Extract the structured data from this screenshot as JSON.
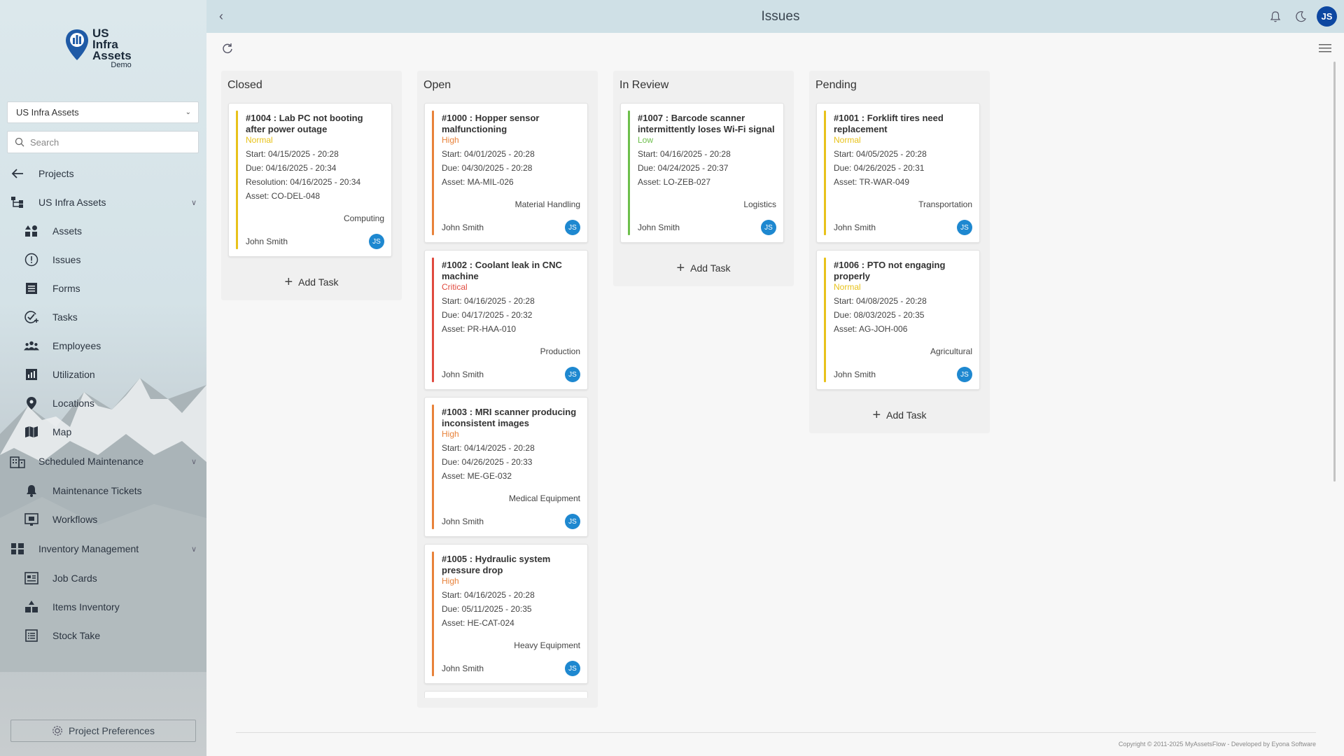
{
  "sidebar": {
    "logo": {
      "line1": "US",
      "line2": "Infra",
      "line3": "Assets",
      "sub": "Demo"
    },
    "project_select": "US Infra Assets",
    "search_placeholder": "Search",
    "items": [
      {
        "label": "Projects",
        "icon": "arrow-left-icon",
        "level": "top"
      },
      {
        "label": "US Infra Assets",
        "icon": "hierarchy-icon",
        "level": "top",
        "expanded": true
      },
      {
        "label": "Assets",
        "icon": "shapes-icon",
        "level": "sub"
      },
      {
        "label": "Issues",
        "icon": "alert-circle-icon",
        "level": "sub"
      },
      {
        "label": "Forms",
        "icon": "form-icon",
        "level": "sub"
      },
      {
        "label": "Tasks",
        "icon": "task-check-icon",
        "level": "sub"
      },
      {
        "label": "Employees",
        "icon": "people-icon",
        "level": "sub"
      },
      {
        "label": "Utilization",
        "icon": "bar-chart-icon",
        "level": "sub"
      },
      {
        "label": "Locations",
        "icon": "location-pin-icon",
        "level": "sub"
      },
      {
        "label": "Map",
        "icon": "map-icon",
        "level": "sub"
      },
      {
        "label": "Scheduled Maintenance",
        "icon": "building-icon",
        "level": "top",
        "expanded": false
      },
      {
        "label": "Maintenance Tickets",
        "icon": "bell-icon",
        "level": "sub"
      },
      {
        "label": "Workflows",
        "icon": "workflow-icon",
        "level": "sub"
      },
      {
        "label": "Inventory Management",
        "icon": "grid-icon",
        "level": "top",
        "expanded": false
      },
      {
        "label": "Job Cards",
        "icon": "card-icon",
        "level": "sub"
      },
      {
        "label": "Items Inventory",
        "icon": "boxes-icon",
        "level": "sub"
      },
      {
        "label": "Stock Take",
        "icon": "list-icon",
        "level": "sub"
      }
    ],
    "preferences_label": "Project Preferences"
  },
  "header": {
    "title": "Issues",
    "user_initials": "JS"
  },
  "board": {
    "add_task_label": "Add Task",
    "columns": [
      {
        "title": "Closed",
        "cards": [
          {
            "title": "#1004 : Lab PC not booting after power outage",
            "priority": "Normal",
            "priority_color": "#e8c21a",
            "lines": [
              "Start:  04/15/2025 - 20:28",
              "Due:  04/16/2025 - 20:34",
              "Resolution:  04/16/2025 - 20:34",
              "Asset: CO-DEL-048"
            ],
            "category": "Computing",
            "assignee": "John Smith",
            "initials": "JS"
          }
        ]
      },
      {
        "title": "Open",
        "cards": [
          {
            "title": "#1000 : Hopper sensor malfunctioning",
            "priority": "High",
            "priority_color": "#e8823a",
            "lines": [
              "Start:  04/01/2025 - 20:28",
              "Due:  04/30/2025 - 20:28",
              "Asset: MA-MIL-026"
            ],
            "category": "Material Handling",
            "assignee": "John Smith",
            "initials": "JS"
          },
          {
            "title": "#1002 : Coolant leak in CNC machine",
            "priority": "Critical",
            "priority_color": "#e04a3f",
            "lines": [
              "Start:  04/16/2025 - 20:28",
              "Due:  04/17/2025 - 20:32",
              "Asset: PR-HAA-010"
            ],
            "category": "Production",
            "assignee": "John Smith",
            "initials": "JS"
          },
          {
            "title": "#1003 : MRI scanner producing inconsistent images",
            "priority": "High",
            "priority_color": "#e8823a",
            "lines": [
              "Start:  04/14/2025 - 20:28",
              "Due:  04/26/2025 - 20:33",
              "Asset: ME-GE-032"
            ],
            "category": "Medical Equipment",
            "assignee": "John Smith",
            "initials": "JS"
          },
          {
            "title": "#1005 : Hydraulic system pressure drop",
            "priority": "High",
            "priority_color": "#e8823a",
            "lines": [
              "Start:  04/16/2025 - 20:28",
              "Due:  05/11/2025 - 20:35",
              "Asset: HE-CAT-024"
            ],
            "category": "Heavy Equipment",
            "assignee": "John Smith",
            "initials": "JS"
          }
        ]
      },
      {
        "title": "In Review",
        "cards": [
          {
            "title": "#1007 : Barcode scanner intermittently loses Wi-Fi signal",
            "priority": "Low",
            "priority_color": "#6dbf4b",
            "lines": [
              "Start:  04/16/2025 - 20:28",
              "Due:  04/24/2025 - 20:37",
              "Asset: LO-ZEB-027"
            ],
            "category": "Logistics",
            "assignee": "John Smith",
            "initials": "JS"
          }
        ]
      },
      {
        "title": "Pending",
        "cards": [
          {
            "title": "#1001 : Forklift tires need replacement",
            "priority": "Normal",
            "priority_color": "#e8c21a",
            "lines": [
              "Start:  04/05/2025 - 20:28",
              "Due:  04/26/2025 - 20:31",
              "Asset: TR-WAR-049"
            ],
            "category": "Transportation",
            "assignee": "John Smith",
            "initials": "JS"
          },
          {
            "title": "#1006 : PTO not engaging properly",
            "priority": "Normal",
            "priority_color": "#e8c21a",
            "lines": [
              "Start:  04/08/2025 - 20:28",
              "Due:  08/03/2025 - 20:35",
              "Asset: AG-JOH-006"
            ],
            "category": "Agricultural",
            "assignee": "John Smith",
            "initials": "JS"
          }
        ]
      }
    ]
  },
  "footer": {
    "copyright": "Copyright © 2011-2025 MyAssetsFlow - Developed by Eyona Software"
  }
}
